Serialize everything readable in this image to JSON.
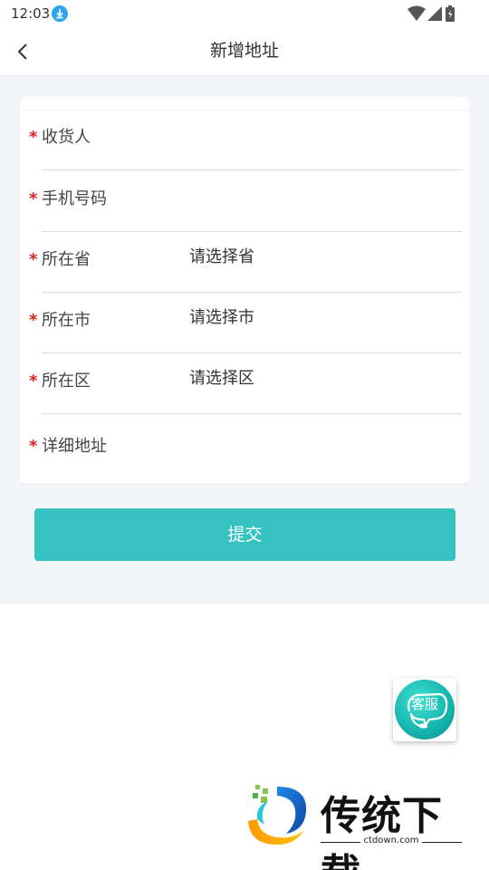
{
  "status_bar": {
    "time": "12:03",
    "download_icon": "download-icon"
  },
  "header": {
    "title": "新增地址",
    "back_icon": "chevron-left-icon"
  },
  "form": {
    "rows": [
      {
        "label": "收货人",
        "value": "",
        "required": true
      },
      {
        "label": "手机号码",
        "value": "",
        "required": true
      },
      {
        "label": "所在省",
        "value": "请选择省",
        "required": true
      },
      {
        "label": "所在市",
        "value": "请选择市",
        "required": true
      },
      {
        "label": "所在区",
        "value": "请选择区",
        "required": true
      },
      {
        "label": "详细地址",
        "value": "",
        "required": true
      }
    ],
    "required_mark": "*",
    "submit_label": "提交"
  },
  "service": {
    "label": "客服"
  },
  "watermark": {
    "title": "传统下载",
    "url": "ctdown.com"
  },
  "colors": {
    "accent": "#35c2c1",
    "required": "#e02020",
    "background": "#f4f5f9"
  }
}
